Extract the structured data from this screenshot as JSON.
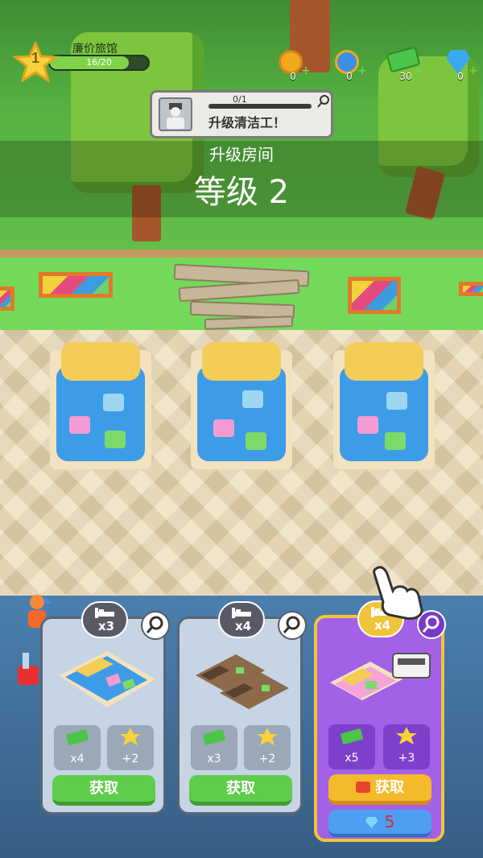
{
  "hud": {
    "level": "1",
    "hotel_name": "廉价旅馆",
    "progress_text": "16/20",
    "progress_fraction": 0.8,
    "resources": [
      {
        "icon": "hotel-coin-icon",
        "value": "0",
        "color": "#f2a81d"
      },
      {
        "icon": "speed-coin-icon",
        "value": "0",
        "color": "#3d8fe6"
      },
      {
        "icon": "cash-icon",
        "value": "30",
        "color": "#4cc44a"
      },
      {
        "icon": "gem-icon",
        "value": "0",
        "color": "#3aa7f0"
      }
    ]
  },
  "task": {
    "count": "0/1",
    "label": "升级清洁工！",
    "progress_fraction": 0
  },
  "upgrade": {
    "title": "升级房间",
    "level": "等级 2"
  },
  "cards": [
    {
      "capacity": "x3",
      "cash_amount": "x4",
      "star_amount": "+2",
      "get_label": "获取",
      "style": "standard"
    },
    {
      "capacity": "x4",
      "cash_amount": "x3",
      "star_amount": "+2",
      "get_label": "获取",
      "style": "standard"
    },
    {
      "capacity": "x4",
      "cash_amount": "x5",
      "star_amount": "+3",
      "get_label": "获取",
      "gem_cost": "5",
      "style": "premium"
    }
  ],
  "colors": {
    "accent_green": "#5fcc4b",
    "premium_purple": "#a261e6",
    "premium_gold": "#f0c43a"
  }
}
